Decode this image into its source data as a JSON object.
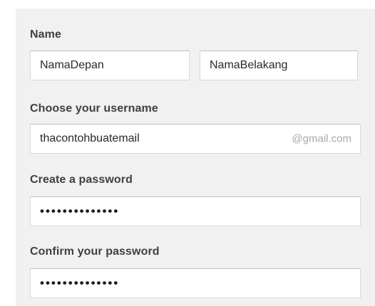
{
  "form": {
    "name_label": "Name",
    "first_name_value": "NamaDepan",
    "last_name_value": "NamaBelakang",
    "username_label": "Choose your username",
    "username_value": "thacontohbuatemail",
    "username_suffix": "@gmail.com",
    "password_label": "Create a password",
    "password_value": "••••••••••••••",
    "confirm_label": "Confirm your password",
    "confirm_value": "••••••••••••••"
  }
}
